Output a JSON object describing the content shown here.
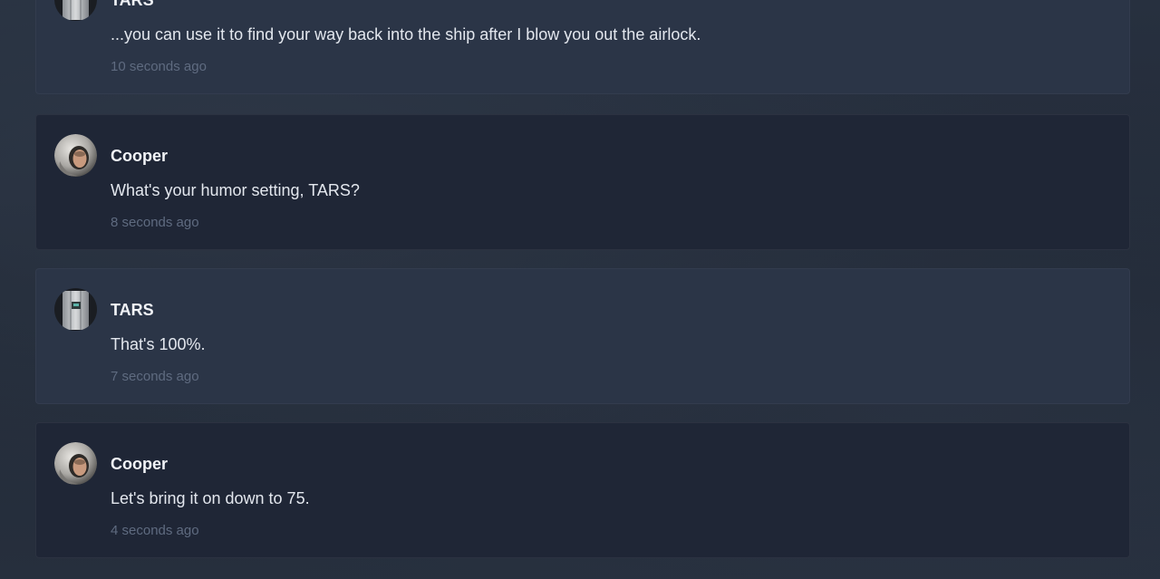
{
  "messages": [
    {
      "author": "TARS",
      "text": "...you can use it to find your way back into the ship after I blow you out the airlock.",
      "time": "10 seconds ago",
      "avatar": "tars-avatar"
    },
    {
      "author": "Cooper",
      "text": "What's your humor setting, TARS?",
      "time": "8 seconds ago",
      "avatar": "cooper-avatar"
    },
    {
      "author": "TARS",
      "text": "That's 100%.",
      "time": "7 seconds ago",
      "avatar": "tars-avatar"
    },
    {
      "author": "Cooper",
      "text": "Let's bring it on down to 75.",
      "time": "4 seconds ago",
      "avatar": "cooper-avatar"
    }
  ],
  "colors": {
    "tars_card": "#2b3547",
    "cooper_card": "#1f2636",
    "timestamp": "#5f6b80"
  }
}
